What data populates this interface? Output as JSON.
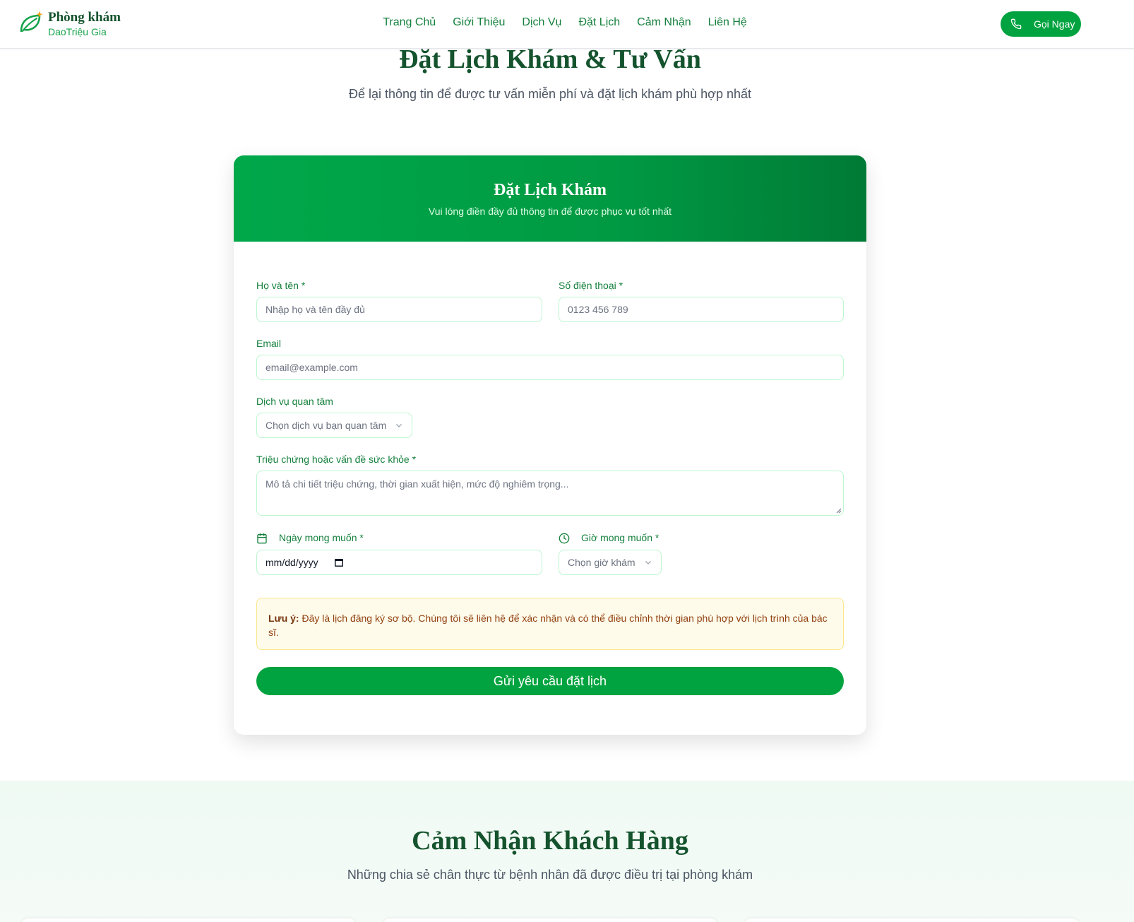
{
  "brand": {
    "line1": "Phòng khám",
    "line2": "DaoTriệu Gia"
  },
  "nav": {
    "items": [
      "Trang Chủ",
      "Giới Thiệu",
      "Dịch Vụ",
      "Đặt Lịch",
      "Cảm Nhận",
      "Liên Hệ"
    ]
  },
  "call": {
    "label": "Gọi Ngay"
  },
  "booking_section": {
    "title": "Đặt Lịch Khám & Tư Vấn",
    "subtitle": "Để lại thông tin để được tư vấn miễn phí và đặt lịch khám phù hợp nhất"
  },
  "form": {
    "header_title": "Đặt Lịch Khám",
    "header_subtitle": "Vui lòng điền đầy đủ thông tin để được phục vụ tốt nhất",
    "name_label": "Họ và tên *",
    "name_placeholder": "Nhập họ và tên đầy đủ",
    "phone_label": "Số điện thoại *",
    "phone_placeholder": "0123 456 789",
    "email_label": "Email",
    "email_placeholder": "email@example.com",
    "service_label": "Dịch vụ quan tâm",
    "service_value": "Chọn dịch vụ bạn quan tâm",
    "symptoms_label": "Triệu chứng hoặc vấn đề sức khỏe *",
    "symptoms_placeholder": "Mô tả chi tiết triệu chứng, thời gian xuất hiện, mức độ nghiêm trọng...",
    "date_label": "Ngày mong muốn *",
    "date_value": "mm/dd/yyyy",
    "time_label": "Giờ mong muốn *",
    "time_value": "Chọn giờ khám",
    "note_bold": "Lưu ý:",
    "note_text": "Đây là lịch đăng ký sơ bộ. Chúng tôi sẽ liên hệ để xác nhận và có thể điều chỉnh thời gian phù hợp với lịch trình của bác sĩ.",
    "submit_label": "Gửi yêu cầu đặt lịch"
  },
  "testimonials": {
    "title": "Cảm Nhận Khách Hàng",
    "subtitle": "Những chia sẻ chân thực từ bệnh nhân đã được điều trị tại phòng khám"
  },
  "colors": {
    "primary": "#00a33f",
    "dark_green": "#14532d",
    "accent_green": "#15803d",
    "note_bg": "#fefbeb"
  },
  "icons": [
    "leaf-logo-icon",
    "phone-icon",
    "chevron-down-icon",
    "calendar-icon",
    "clock-icon"
  ]
}
